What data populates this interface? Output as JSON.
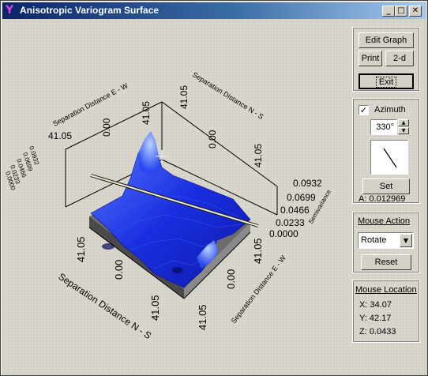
{
  "window": {
    "title": "Anisotropic Variogram Surface",
    "controls": {
      "minimize": "_",
      "maximize": "□",
      "close": "✕"
    }
  },
  "toolbar": {
    "edit_graph": "Edit Graph",
    "print": "Print",
    "two_d": "2-d",
    "exit": "Exit"
  },
  "azimuth": {
    "label": "Azimuth",
    "checked": true,
    "value": "330°",
    "set_label": "Set",
    "a_readout": "A: 0.012969"
  },
  "mouse_action": {
    "heading": "Mouse Action",
    "selected": "Rotate",
    "reset_label": "Reset"
  },
  "mouse_location": {
    "heading": "Mouse Location",
    "x": "X: 34.07",
    "y": "Y: 42.17",
    "z": "Z: 0.0433"
  },
  "plot": {
    "axis_ns_label": "Separation Distance N - S",
    "axis_ew_label": "Separation Distance E - W",
    "z_label": "Semivariance",
    "top_back_ticks": [
      "41.05",
      "0.00",
      "41.05"
    ],
    "top_left_ticks": [
      "41.05",
      "0.00",
      "41.05"
    ],
    "z_right_ticks": [
      "0.0932",
      "0.0699",
      "0.0466",
      "0.0233",
      "0.0000"
    ],
    "z_left_ticks": [
      "0.0932",
      "0.0699",
      "0.0466",
      "0.0233",
      "0.0000"
    ],
    "bottom_ns_ticks": [
      "41.05",
      "0.00",
      "41.05"
    ],
    "bottom_ew_ticks": [
      "41.05",
      "0.00",
      "41.05"
    ],
    "surface_color": "#1e36e8",
    "highlight_color": "#6ea6ff",
    "azimuth_line_color": "#f0ecd0"
  }
}
